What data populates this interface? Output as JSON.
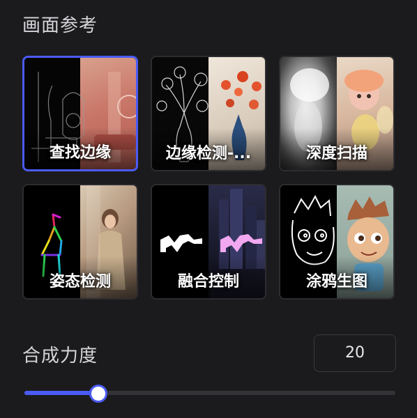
{
  "section": {
    "title": "画面参考"
  },
  "references": [
    {
      "label": "查找边缘",
      "selected": true,
      "icon": "edge-detect-thumbnail"
    },
    {
      "label": "边缘检测-...",
      "selected": false,
      "icon": "edge-detect-flowers-thumbnail"
    },
    {
      "label": "深度扫描",
      "selected": false,
      "icon": "depth-scan-thumbnail"
    },
    {
      "label": "姿态检测",
      "selected": false,
      "icon": "pose-detect-thumbnail"
    },
    {
      "label": "融合控制",
      "selected": false,
      "icon": "blend-control-thumbnail"
    },
    {
      "label": "涂鸦生图",
      "selected": false,
      "icon": "doodle-thumbnail"
    }
  ],
  "strength": {
    "label": "合成力度",
    "value": "20",
    "slider_fraction": 0.2
  },
  "colors": {
    "accent": "#4b5bf5",
    "background": "#1b1b1d",
    "card_border": "#2d2d31",
    "track": "#333337"
  }
}
